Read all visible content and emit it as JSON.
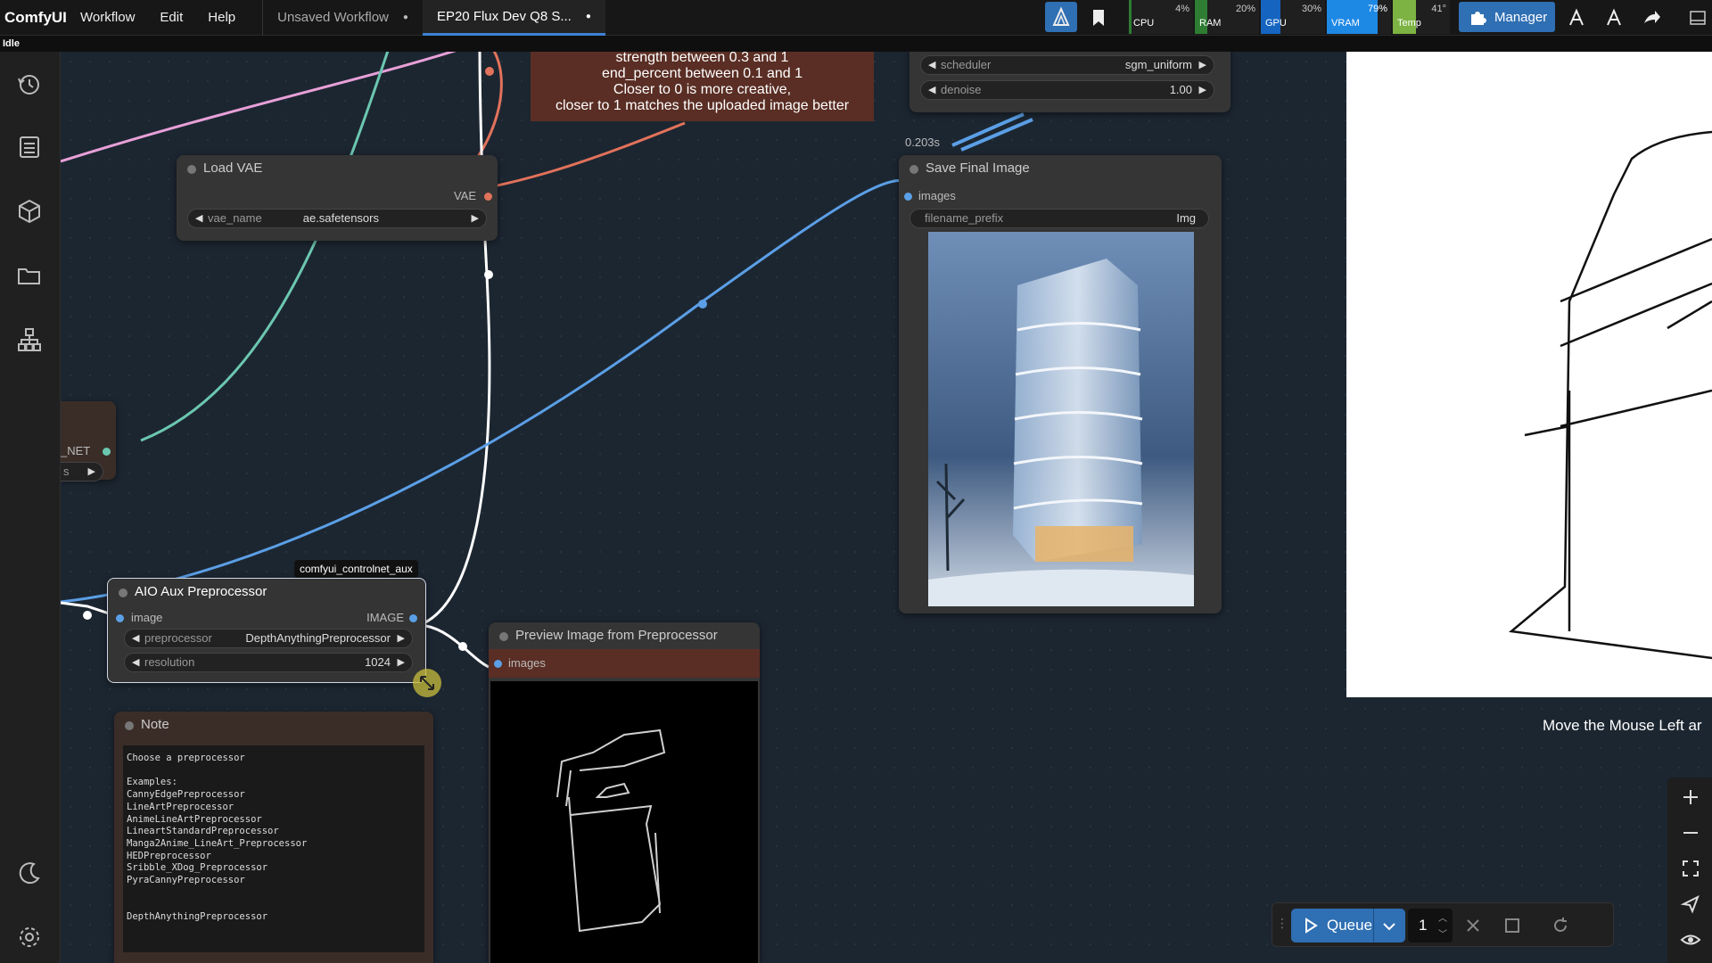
{
  "app": {
    "brand": "ComfyUI",
    "menu": [
      "Workflow",
      "Edit",
      "Help"
    ],
    "tabs": [
      {
        "label": "Unsaved Workflow",
        "active": false
      },
      {
        "label": "EP20 Flux Dev Q8 S...",
        "active": true
      }
    ],
    "status": "Idle"
  },
  "monitors": {
    "cpu": {
      "label": "CPU",
      "value": "4%",
      "color": "#2e7d32"
    },
    "ram": {
      "label": "RAM",
      "value": "20%",
      "color": "#2e7d32"
    },
    "gpu": {
      "label": "GPU",
      "value": "30%",
      "color": "#1565c0"
    },
    "vram": {
      "label": "VRAM",
      "value": "79%",
      "color": "#1e88e5"
    },
    "temp": {
      "label": "Temp",
      "value": "41°",
      "color": "#7cb342"
    }
  },
  "header_buttons": {
    "manager": "Manager"
  },
  "instructions": {
    "line1": "strength between 0.3 and 1",
    "line2": "end_percent between 0.1 and 1",
    "line3": "Closer to 0 is more creative,",
    "line4": "closer to 1 matches the uploaded image better"
  },
  "sampler_partial": {
    "scheduler_label": "scheduler",
    "scheduler_value": "sgm_uniform",
    "denoise_label": "denoise",
    "denoise_value": "1.00",
    "timing": "0.203s"
  },
  "load_vae": {
    "title": "Load VAE",
    "output": "VAE",
    "vae_name_label": "vae_name",
    "vae_name_value": "ae.safetensors"
  },
  "save_image": {
    "title": "Save Final Image",
    "input": "images",
    "prefix_label": "filename_prefix",
    "prefix_value": "Img"
  },
  "partial_node": {
    "output": "_NET",
    "widget": "s"
  },
  "aio": {
    "badge": "comfyui_controlnet_aux",
    "title": "AIO Aux Preprocessor",
    "input": "image",
    "output": "IMAGE",
    "preprocessor_label": "preprocessor",
    "preprocessor_value": "DepthAnythingPreprocessor",
    "resolution_label": "resolution",
    "resolution_value": "1024"
  },
  "preview": {
    "title": "Preview Image from Preprocessor",
    "input": "images"
  },
  "note": {
    "title": "Note",
    "text": "Choose a preprocessor\n\nExamples:\nCannyEdgePreprocessor\nLineArtPreprocessor\nAnimeLineArtPreprocessor\nLineartStandardPreprocessor\nManga2Anime_LineArt_Preprocessor\nHEDPreprocessor\nSribble_XDog_Preprocessor\nPyraCannyPreprocessor\n\n\nDepthAnythingPreprocessor"
  },
  "caption": "Move the Mouse Left ar",
  "queue": {
    "label": "Queue",
    "count": "1"
  },
  "colors": {
    "accent": "#3b82d6",
    "link_blue": "#5b9fe6",
    "link_red": "#e2725b",
    "link_teal": "#6cc7b0",
    "link_pink": "#e8a0d8",
    "node_red": "#5a2e24"
  }
}
